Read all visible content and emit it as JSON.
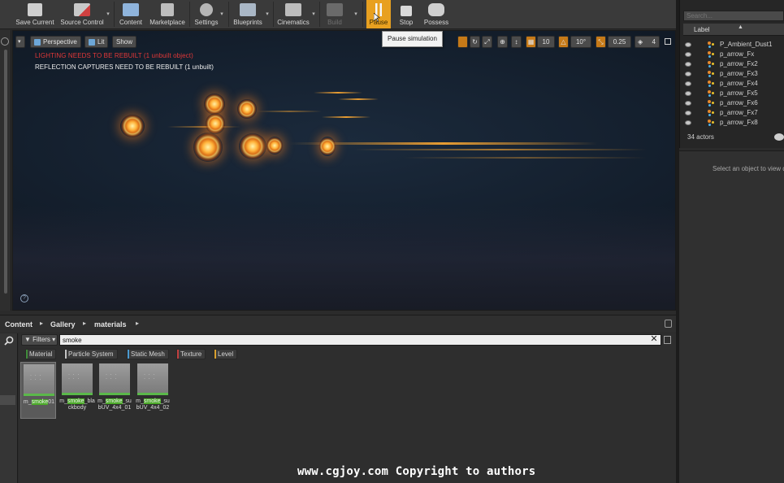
{
  "toolbar": {
    "save": "Save Current",
    "source_control": "Source Control",
    "content": "Content",
    "marketplace": "Marketplace",
    "settings": "Settings",
    "blueprints": "Blueprints",
    "cinematics": "Cinematics",
    "build": "Build",
    "pause": "Pause",
    "stop": "Stop",
    "possess": "Possess"
  },
  "tooltip": "Pause simulation",
  "viewport": {
    "perspective": "Perspective",
    "lit": "Lit",
    "show": "Show",
    "warning_lighting": "LIGHTING NEEDS TO BE REBUILT (1 unbuilt object)",
    "warning_reflection": "REFLECTION CAPTURES NEED TO BE REBUILT (1 unbuilt)",
    "grid_snap": "10",
    "rotation_snap": "10°",
    "scale_snap": "0.25",
    "camera_speed": "4"
  },
  "outliner": {
    "search_placeholder": "Search...",
    "column_label": "Label",
    "items": [
      "P_Ambient_Dust1",
      "p_arrow_Fx",
      "p_arrow_Fx2",
      "p_arrow_Fx3",
      "p_arrow_Fx4",
      "p_arrow_Fx5",
      "p_arrow_Fx6",
      "p_arrow_Fx7",
      "p_arrow_Fx8"
    ],
    "actor_count": "34 actors"
  },
  "details": {
    "hint": "Select an object to view details."
  },
  "content_browser": {
    "path": [
      "Content",
      "Gallery",
      "materials"
    ],
    "filters": "Filters",
    "search_value": "smoke",
    "filter_chips": [
      "Material",
      "Particle System",
      "Static Mesh",
      "Texture",
      "Level"
    ],
    "assets": [
      {
        "pre": "m_",
        "hl": "smoke",
        "post": "01"
      },
      {
        "pre": "m_",
        "hl": "smoke",
        "post": "_blackbody"
      },
      {
        "pre": "m_",
        "hl": "smoke",
        "post": "_subUV_4x4_01"
      },
      {
        "pre": "m_",
        "hl": "smoke",
        "post": "_subUV_4x4_02"
      }
    ]
  },
  "watermark": "www.cgjoy.com Copyright to authors",
  "colors": {
    "pause_accent": "#e8a020",
    "warning_red": "#e23838",
    "search_highlight": "#4caa2a",
    "fire_orange": "#ffa030"
  }
}
